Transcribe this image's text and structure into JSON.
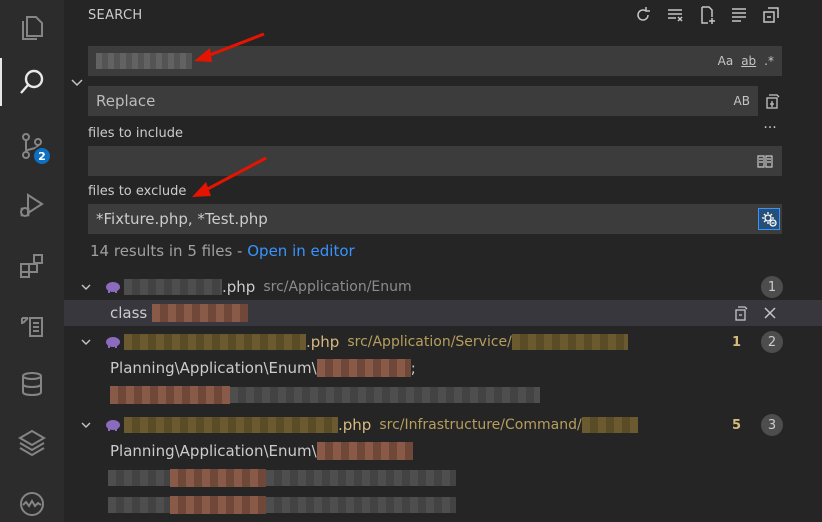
{
  "panel": {
    "title": "SEARCH"
  },
  "activity_bar": {
    "items": [
      "explorer-icon",
      "search-icon",
      "source-control-icon",
      "run-debug-icon",
      "extensions-icon",
      "remote-explorer-icon",
      "database-icon",
      "layers-icon",
      "monitor-icon"
    ],
    "scm_badge": "2"
  },
  "header_actions": [
    "refresh-icon",
    "clear-results-icon",
    "new-search-editor-icon",
    "view-as-tree-icon",
    "collapse-all-icon"
  ],
  "search": {
    "value": "",
    "options": {
      "match_case": "Aa",
      "whole_word": "ab",
      "regex": ".*"
    }
  },
  "replace": {
    "placeholder": "Replace",
    "preserve_case": "AB"
  },
  "files_include": {
    "label": "files to include",
    "value": ""
  },
  "files_exclude": {
    "label": "files to exclude",
    "value": "*Fixture.php, *Test.php"
  },
  "more_options": "···",
  "results": {
    "summary": "14 results in 5 files - ",
    "open_in_editor": "Open in editor"
  },
  "files": [
    {
      "ext": ".php",
      "path": "src/Application/Enum",
      "count": "1",
      "modified_count": "",
      "matches": [
        {
          "prefix": "class "
        }
      ]
    },
    {
      "ext": ".php",
      "path": "src/Application/Service/",
      "count": "2",
      "modified_count": "1",
      "matches": [
        {
          "prefix": "Planning\\Application\\Enum\\",
          "suffix": ";"
        }
      ]
    },
    {
      "ext": ".php",
      "path": "src/Infrastructure/Command/",
      "count": "3",
      "modified_count": "5",
      "matches": [
        {
          "prefix": "Planning\\Application\\Enum\\"
        }
      ]
    }
  ],
  "colors": {
    "accent": "#3794ff",
    "badge": "#0e70c0",
    "modified": "#d7ba7d",
    "arrow": "#e51400"
  }
}
